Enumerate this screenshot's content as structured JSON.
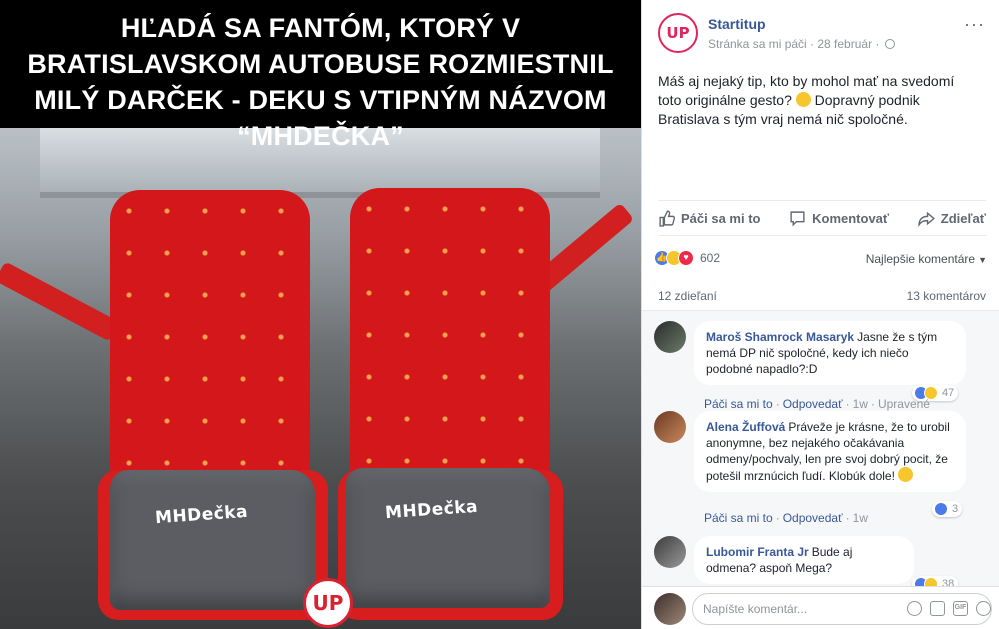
{
  "photo": {
    "headline": "HĽADÁ SA FANTÓM, KTORÝ V BRATISLAVSKOM AUTOBUSE ROZMIESTNIL MILÝ DARČEK - DEKU S VTIPNÝM NÁZVOM “MHDEČKA”",
    "blanket_text_1": "MHDečka",
    "blanket_text_2": "MHDečka",
    "watermark_logo": "UP"
  },
  "post": {
    "page_name": "Startitup",
    "avatar_text": "UP",
    "meta": "Stránka sa mi páči · 28 február ·",
    "more": "···",
    "text": "Máš aj nejaký tip, kto by mohol mať na svedomí toto originálne gesto?",
    "text_after_emoji": "Dopravný podnik Bratislava s tým vraj nemá nič spoločné."
  },
  "actions": {
    "like": "Páči sa mi to",
    "comment": "Komentovať",
    "share": "Zdieľať"
  },
  "reactions": {
    "count": "602",
    "sort_label": "Najlepšie komentáre"
  },
  "stats": {
    "shares": "12 zdieľaní",
    "comments": "13 komentárov"
  },
  "comments": [
    {
      "author": "Maroš Shamrock Masaryk",
      "text": "Jasne že s tým nemá DP nič spoločné, kedy ich niečo podobné napadlo?:D",
      "like": "Páči sa mi to",
      "reply": "Odpovedať",
      "time": "1w",
      "edited": "Upravené",
      "reactions": "47"
    },
    {
      "author": "Alena Žuffová",
      "text": "Práveže je krásne, že to urobil anonymne, bez nejakého očakávania odmeny/pochvaly, len pre svoj dobrý pocit, že potešil mrznúcich ľudí. Klobúk dole!",
      "like": "Páči sa mi to",
      "reply": "Odpovedať",
      "time": "1w",
      "reactions": "3"
    },
    {
      "author": "Lubomir Franta Jr",
      "text": "Bude aj odmena? aspoň Mega?",
      "reactions": "38"
    }
  ],
  "composer": {
    "placeholder": "Napíšte komentár..."
  },
  "colors": {
    "brand_red": "#e0245e",
    "link_blue": "#385898",
    "like_blue": "#4a7be8"
  }
}
